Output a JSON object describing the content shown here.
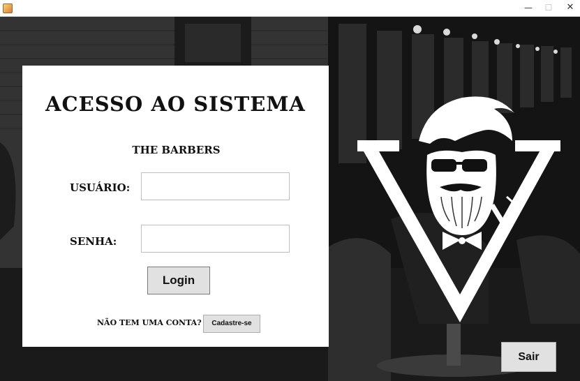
{
  "window": {
    "minimize_glyph": "—",
    "maximize_glyph": "☐",
    "close_glyph": "✕"
  },
  "login_panel": {
    "title": "ACESSO AO SISTEMA",
    "subtitle": "THE BARBERS",
    "username_label": "USUÁRIO:",
    "username_value": "",
    "password_label": "SENHA:",
    "password_value": "",
    "login_button": "Login",
    "no_account_text": "NÃO TEM UMA CONTA?",
    "register_button": "Cadastre-se"
  },
  "exit_button": "Sair",
  "background": {
    "description_icon": "barbershop-photo",
    "logo_icon": "bearded-barber-logo-icon"
  }
}
